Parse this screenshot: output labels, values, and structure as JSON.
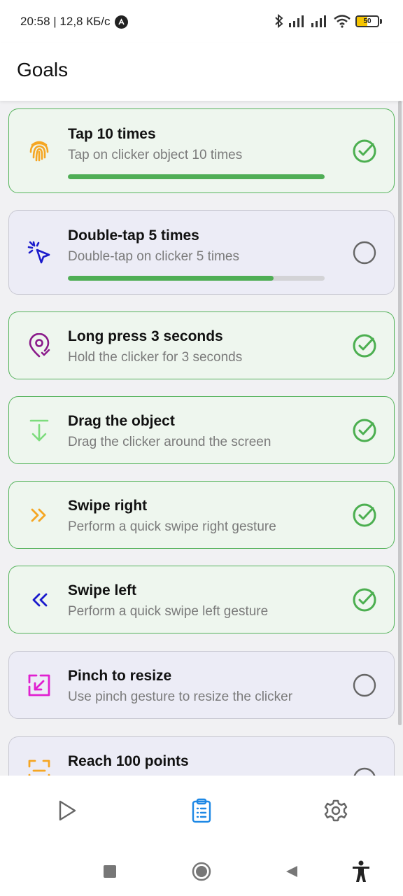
{
  "status_bar": {
    "time_speed": "20:58 | 12,8 КБ/с",
    "battery_level": "50"
  },
  "app_bar": {
    "title": "Goals"
  },
  "colors": {
    "completed_border": "#55b35b",
    "completed_bg": "#eef6ee",
    "pending_border": "#c9c9d3",
    "pending_bg": "#ececf6",
    "check_green": "#4caf50",
    "progress_green": "#4fae55",
    "nav_active": "#1e88e5"
  },
  "goals": [
    {
      "title": "Tap 10 times",
      "description": "Tap on clicker object 10 times",
      "icon": "fingerprint-icon",
      "icon_color": "#f5a623",
      "completed": true,
      "progress": 1.0
    },
    {
      "title": "Double-tap 5 times",
      "description": "Double-tap on clicker 5 times",
      "icon": "pointer-click-icon",
      "icon_color": "#1a1acc",
      "completed": false,
      "progress": 0.8
    },
    {
      "title": "Long press 3 seconds",
      "description": "Hold the clicker for 3 seconds",
      "icon": "location-check-icon",
      "icon_color": "#8a1a8a",
      "completed": true
    },
    {
      "title": "Drag the object",
      "description": "Drag the clicker around the screen",
      "icon": "arrow-down-icon",
      "icon_color": "#7ddc7d",
      "completed": true
    },
    {
      "title": "Swipe right",
      "description": "Perform a quick swipe right gesture",
      "icon": "double-chevron-right-icon",
      "icon_color": "#f5a623",
      "completed": true
    },
    {
      "title": "Swipe left",
      "description": "Perform a quick swipe left gesture",
      "icon": "double-chevron-left-icon",
      "icon_color": "#1a1acc",
      "completed": true
    },
    {
      "title": "Pinch to resize",
      "description": "Use pinch gesture to resize the clicker",
      "icon": "resize-arrow-icon",
      "icon_color": "#e020d0",
      "completed": false
    },
    {
      "title": "Reach 100 points",
      "description": "",
      "icon": "scan-icon",
      "icon_color": "#f5a623",
      "completed": false
    }
  ],
  "bottom_nav": {
    "items": [
      {
        "name": "play",
        "active": false
      },
      {
        "name": "goals",
        "active": true
      },
      {
        "name": "settings",
        "active": false
      }
    ]
  }
}
